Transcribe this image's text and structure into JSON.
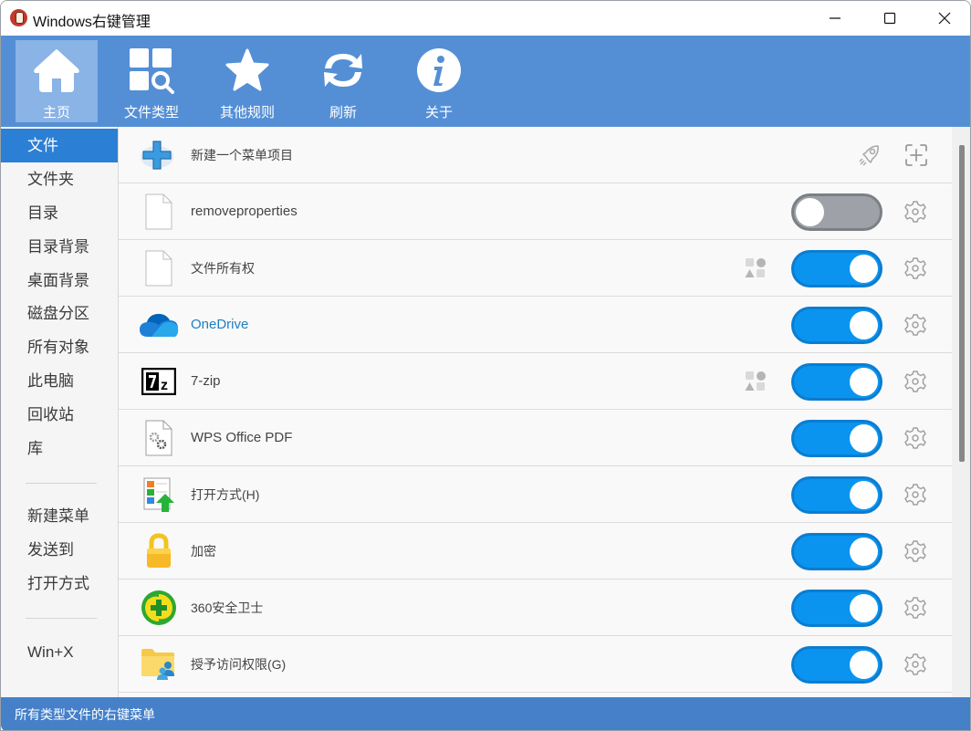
{
  "window": {
    "title": "Windows右键管理",
    "controls": [
      "minimize",
      "maximize",
      "close"
    ]
  },
  "toolbar": {
    "items": [
      {
        "label": "主页",
        "icon": "home-icon",
        "active": true
      },
      {
        "label": "文件类型",
        "icon": "file-type-search-icon",
        "active": false
      },
      {
        "label": "其他规则",
        "icon": "star-icon",
        "active": false
      },
      {
        "label": "刷新",
        "icon": "refresh-icon",
        "active": false
      },
      {
        "label": "关于",
        "icon": "info-icon",
        "active": false
      }
    ]
  },
  "sidebar": {
    "items": [
      {
        "label": "文件",
        "active": true
      },
      {
        "label": "文件夹"
      },
      {
        "label": "目录"
      },
      {
        "label": "目录背景"
      },
      {
        "label": "桌面背景"
      },
      {
        "label": "磁盘分区"
      },
      {
        "label": "所有对象"
      },
      {
        "label": "此电脑"
      },
      {
        "label": "回收站"
      },
      {
        "label": "库"
      }
    ],
    "group2": [
      {
        "label": "新建菜单"
      },
      {
        "label": "发送到"
      },
      {
        "label": "打开方式"
      }
    ],
    "group3": [
      {
        "label": "Win+X"
      }
    ]
  },
  "list": {
    "new_item": {
      "label": "新建一个菜单项目",
      "icon": "plus-icon",
      "actions": [
        "rocket-icon",
        "add-box-icon"
      ]
    },
    "rows": [
      {
        "label": "removeproperties",
        "icon": "blank-file-icon",
        "enabled": false,
        "shapes": false
      },
      {
        "label": "文件所有权",
        "icon": "blank-file-icon",
        "enabled": true,
        "shapes": true
      },
      {
        "label": "OneDrive",
        "icon": "onedrive-cloud-icon",
        "enabled": true,
        "shapes": false,
        "link": true
      },
      {
        "label": "7-zip",
        "icon": "7zip-icon",
        "enabled": true,
        "shapes": true
      },
      {
        "label": "WPS Office PDF",
        "icon": "gear-file-icon",
        "enabled": true,
        "shapes": false
      },
      {
        "label": "打开方式(H)",
        "icon": "open-with-icon",
        "enabled": true,
        "shapes": false
      },
      {
        "label": "加密",
        "icon": "lock-icon",
        "enabled": true,
        "shapes": false
      },
      {
        "label": "360安全卫士",
        "icon": "360-safe-icon",
        "enabled": true,
        "shapes": false
      },
      {
        "label": "授予访问权限(G)",
        "icon": "share-folder-icon",
        "enabled": true,
        "shapes": false
      }
    ]
  },
  "status": {
    "text": "所有类型文件的右键菜单"
  },
  "colors": {
    "toolbar_bg": "#548fd6",
    "active_sidebar": "#2b7fd4",
    "toggle_on": "#0a94f0",
    "toggle_off": "#9ea2a8",
    "statusbar_bg": "#4580c9",
    "link_text": "#1d7fc4"
  }
}
